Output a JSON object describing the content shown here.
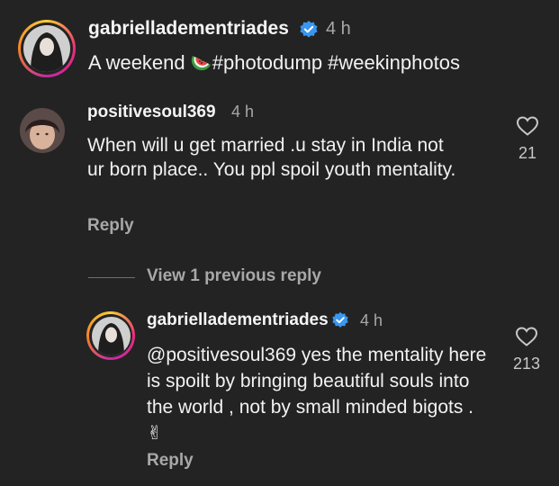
{
  "post": {
    "username": "gabrielladementriades",
    "time": "4 h",
    "caption_pre": "A weekend ",
    "caption_post": "#photodump #weekinphotos"
  },
  "comment1": {
    "username": "positivesoul369",
    "time": "4 h",
    "text": "When will u get married .u stay in India not ur born place.. You ppl spoil youth mentality.",
    "reply_label": "Reply",
    "likes": "21"
  },
  "view_replies": "View 1 previous reply",
  "reply1": {
    "username": "gabrielladementriades",
    "time": "4 h",
    "text": "@positivesoul369 yes the mentality here is spoilt by bringing beautiful souls into the world , not by small minded bigots . ✌",
    "reply_label": "Reply",
    "likes": "213"
  },
  "colors": {
    "background": "#232323",
    "verified": "#3897f0",
    "muted": "#a8a8a8"
  }
}
